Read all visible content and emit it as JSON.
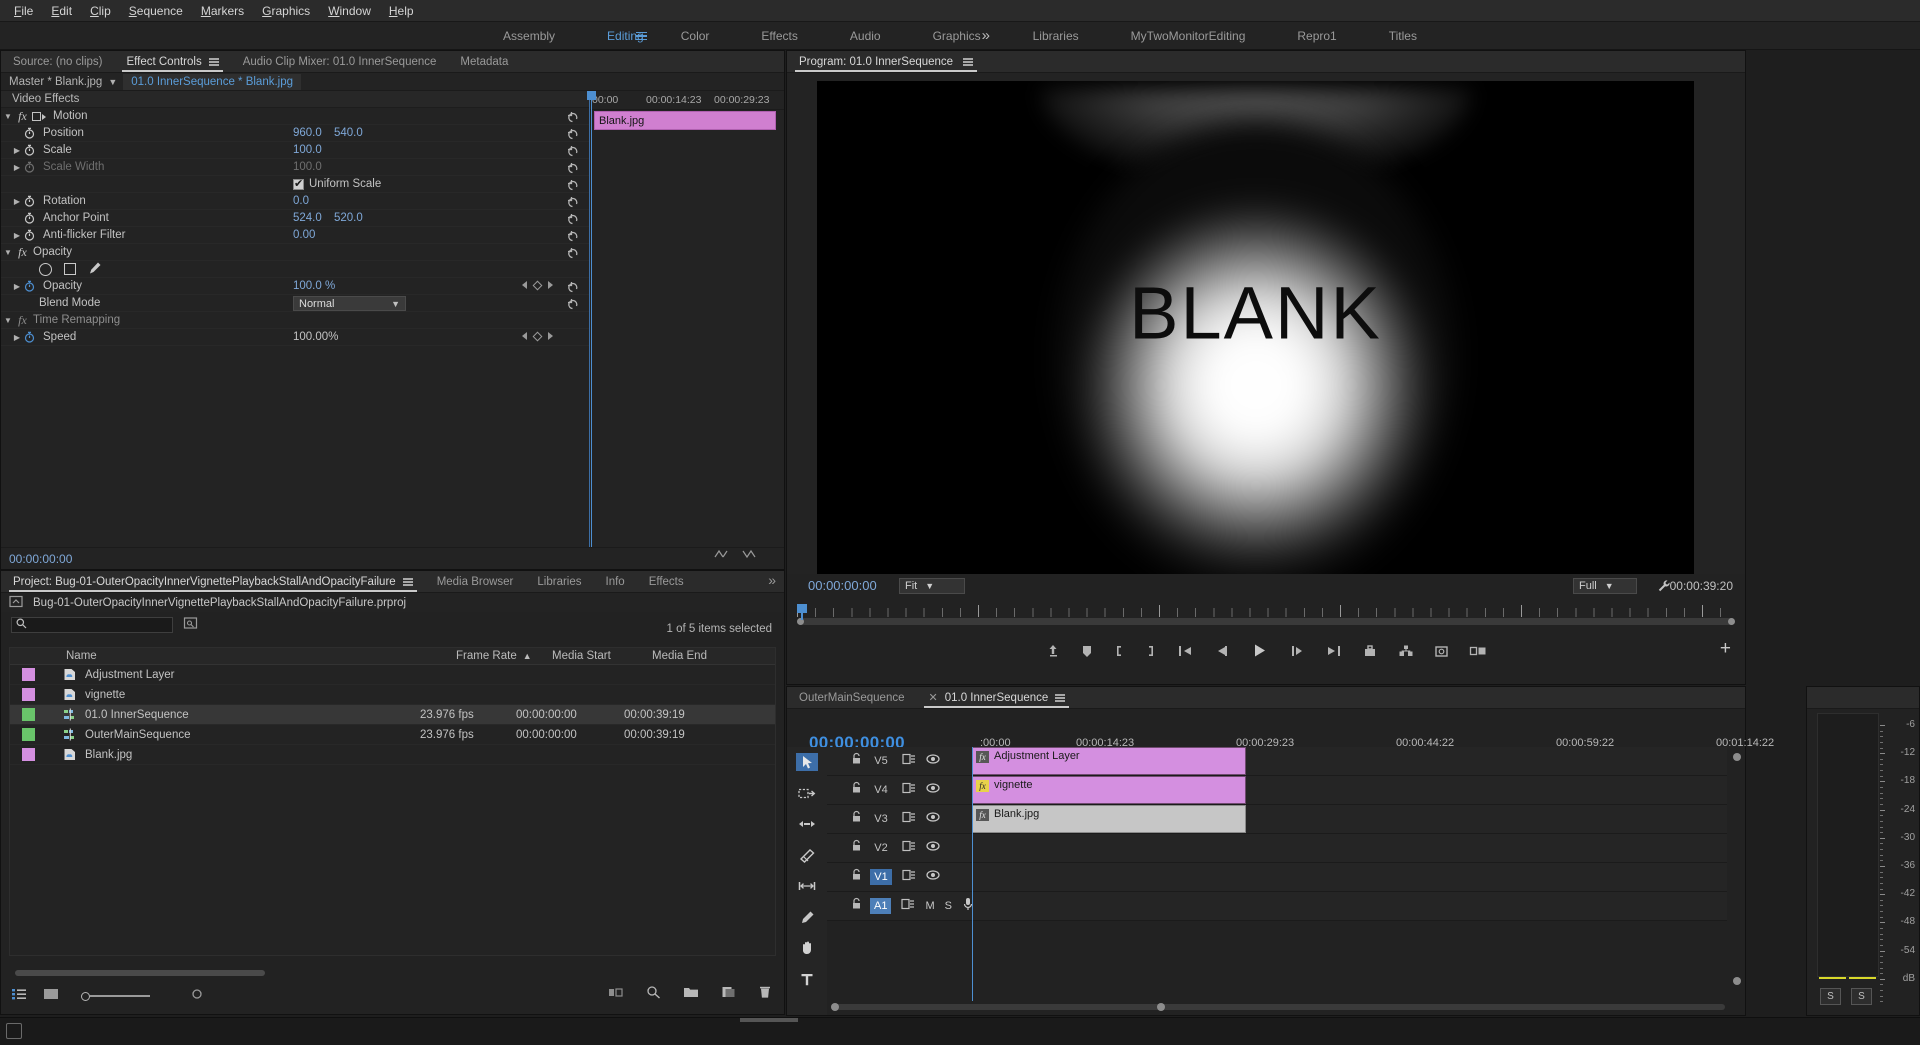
{
  "menubar": {
    "items": [
      "File",
      "Edit",
      "Clip",
      "Sequence",
      "Markers",
      "Graphics",
      "Window",
      "Help"
    ]
  },
  "workspaces": {
    "items": [
      "Assembly",
      "Editing",
      "Color",
      "Effects",
      "Audio",
      "Graphics",
      "Libraries",
      "MyTwoMonitorEditing",
      "Repro1",
      "Titles"
    ],
    "active": "Editing",
    "overflow": "»"
  },
  "effect_controls": {
    "tabs": [
      {
        "label": "Source: (no clips)",
        "active": false
      },
      {
        "label": "Effect Controls",
        "active": true
      },
      {
        "label": "Audio Clip Mixer: 01.0 InnerSequence",
        "active": false
      },
      {
        "label": "Metadata",
        "active": false
      }
    ],
    "breadcrumb_master": "Master * Blank.jpg",
    "breadcrumb_sequence": "01.0 InnerSequence * Blank.jpg",
    "section_title": "Video Effects",
    "groups": [
      {
        "name": "Motion",
        "properties": [
          {
            "label": "Position",
            "v1": "960.0",
            "v2": "540.0",
            "twist": false,
            "dim": false
          },
          {
            "label": "Scale",
            "v1": "100.0",
            "v2": "",
            "twist": true,
            "dim": false
          },
          {
            "label": "Scale Width",
            "v1": "100.0",
            "v2": "",
            "twist": true,
            "dim": true
          },
          {
            "label": "Rotation",
            "v1": "0.0",
            "v2": "",
            "twist": true,
            "dim": false
          },
          {
            "label": "Anchor Point",
            "v1": "524.0",
            "v2": "520.0",
            "twist": false,
            "dim": false
          },
          {
            "label": "Anti-flicker Filter",
            "v1": "0.00",
            "v2": "",
            "twist": true,
            "dim": false
          }
        ],
        "uniform_scale_label": "Uniform Scale",
        "uniform_scale_checked": true
      },
      {
        "name": "Opacity",
        "properties": [
          {
            "label": "Opacity",
            "v1": "100.0 %",
            "v2": "",
            "twist": true,
            "dim": false
          }
        ],
        "blend_mode_label": "Blend Mode",
        "blend_mode_value": "Normal"
      },
      {
        "name": "Time Remapping",
        "properties": [
          {
            "label": "Speed",
            "v1": "100.00%",
            "v2": "",
            "twist": true,
            "dim": false
          }
        ]
      }
    ],
    "timeline_ticks": [
      "00:00",
      "00:00:14:23",
      "00:00:29:23"
    ],
    "clip_label": "Blank.jpg",
    "footer_timecode": "00:00:00:00"
  },
  "program_monitor": {
    "title": "Program: 01.0 InnerSequence",
    "video_text": "BLANK",
    "timecode_current": "00:00:00:00",
    "zoom_level": "Fit",
    "resolution": "Full",
    "duration": "00:00:39:20",
    "buttons": [
      "export-frame",
      "add-marker",
      "mark-in",
      "mark-out",
      "go-to-in",
      "step-back",
      "play-stop",
      "step-forward",
      "go-to-out",
      "lift",
      "extract",
      "export-frame-camera",
      "comparison-view"
    ],
    "plus_label": "+"
  },
  "project_panel": {
    "tabs": [
      {
        "label": "Project: Bug-01-OuterOpacityInnerVignettePlaybackStallAndOpacityFailure",
        "active": true
      },
      {
        "label": "Media Browser",
        "active": false
      },
      {
        "label": "Libraries",
        "active": false
      },
      {
        "label": "Info",
        "active": false
      },
      {
        "label": "Effects",
        "active": false
      }
    ],
    "overflow": "»",
    "project_file": "Bug-01-OuterOpacityInnerVignettePlaybackStallAndOpacityFailure.prproj",
    "search_placeholder": "",
    "search_value": "",
    "selection_status": "1 of 5 items selected",
    "columns": [
      "Name",
      "Frame Rate",
      "Media Start",
      "Media End"
    ],
    "sort_column": "Frame Rate",
    "rows": [
      {
        "name": "Adjustment Layer",
        "frame_rate": "",
        "media_start": "",
        "media_end": "",
        "swatch": "#d48fe0",
        "kind": "graphic",
        "selected": false
      },
      {
        "name": "vignette",
        "frame_rate": "",
        "media_start": "",
        "media_end": "",
        "swatch": "#d48fe0",
        "kind": "graphic",
        "selected": false
      },
      {
        "name": "01.0 InnerSequence",
        "frame_rate": "23.976 fps",
        "media_start": "00:00:00:00",
        "media_end": "00:00:39:19",
        "swatch": "#69c46a",
        "kind": "sequence",
        "selected": true
      },
      {
        "name": "OuterMainSequence",
        "frame_rate": "23.976 fps",
        "media_start": "00:00:00:00",
        "media_end": "00:00:39:19",
        "swatch": "#69c46a",
        "kind": "sequence",
        "selected": false
      },
      {
        "name": "Blank.jpg",
        "frame_rate": "",
        "media_start": "",
        "media_end": "",
        "swatch": "#d48fe0",
        "kind": "graphic",
        "selected": false
      }
    ]
  },
  "timeline": {
    "tabs": [
      {
        "label": "OuterMainSequence",
        "active": false,
        "closable": false
      },
      {
        "label": "01.0 InnerSequence",
        "active": true,
        "closable": true
      }
    ],
    "playhead_timecode": "00:00:00:00",
    "ruler_labels": [
      ":00:00",
      "00:00:14:23",
      "00:00:29:23",
      "00:00:44:22",
      "00:00:59:22",
      "00:01:14:22"
    ],
    "tools": [
      "selection-tool",
      "track-select-forward-tool",
      "ripple-edit-tool",
      "razor-tool",
      "slip-tool",
      "pen-tool",
      "hand-tool",
      "type-tool"
    ],
    "header_tools": [
      "snap-toggle",
      "magnet-icon",
      "linked-selection-icon",
      "add-marker-icon",
      "timeline-settings-icon"
    ],
    "tracks": [
      {
        "name": "V5",
        "clip": "Adjustment Layer",
        "color": "purple",
        "fx": "fx",
        "fx_color": "grey",
        "locked": false
      },
      {
        "name": "V4",
        "clip": "vignette",
        "color": "purple",
        "fx": "fx",
        "fx_color": "yellow",
        "locked": false
      },
      {
        "name": "V3",
        "clip": "Blank.jpg",
        "color": "grey",
        "fx": "fx",
        "fx_color": "grey",
        "locked": false
      },
      {
        "name": "V2",
        "clip": "",
        "color": "none",
        "fx": "",
        "fx_color": "",
        "locked": false
      },
      {
        "name": "V1",
        "clip": "",
        "color": "none",
        "fx": "",
        "fx_color": "",
        "locked": false,
        "selected": true
      },
      {
        "name": "A1",
        "clip": "",
        "color": "none",
        "fx": "",
        "fx_color": "",
        "locked": false,
        "audio": true,
        "mute": "M",
        "solo": "S"
      }
    ]
  },
  "audio_meters": {
    "scale": [
      "-6",
      "-12",
      "-18",
      "-24",
      "-30",
      "-36",
      "-42",
      "-48",
      "-54",
      "dB"
    ],
    "solo_buttons": [
      "S",
      "S"
    ]
  }
}
